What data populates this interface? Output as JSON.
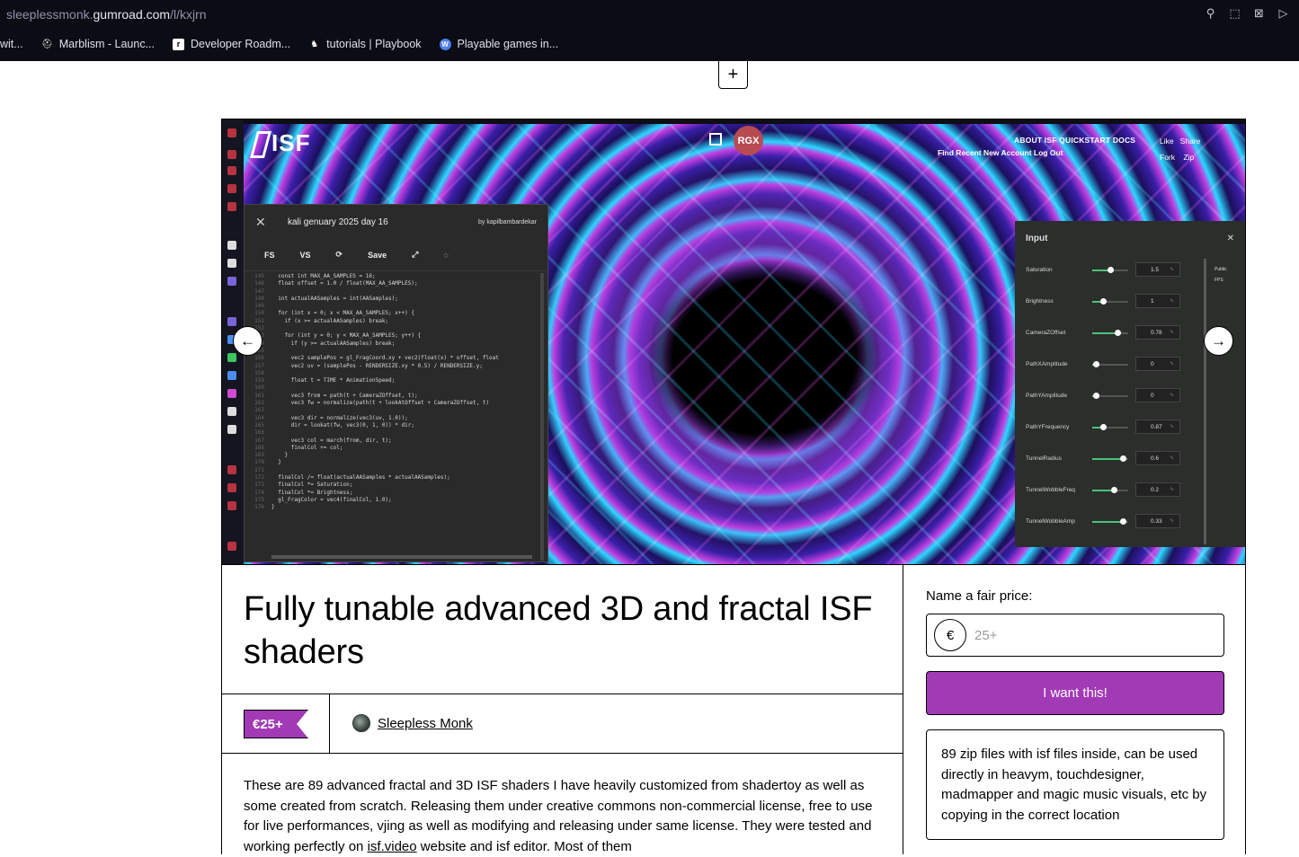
{
  "browser": {
    "url_prefix": "sleeplessmonk.",
    "url_host": "gumroad.com",
    "url_path": "/l/kxjrn",
    "bookmarks": [
      {
        "label": "wit...",
        "icon": "none"
      },
      {
        "label": "Marblism - Launc...",
        "icon": "marblism-icon"
      },
      {
        "label": "Developer Roadm...",
        "icon": "roadmap-icon"
      },
      {
        "label": "tutorials | Playbook",
        "icon": "playbook-icon"
      },
      {
        "label": "Playable games in...",
        "icon": "wordpress-icon"
      }
    ]
  },
  "page": {
    "add_label": "+"
  },
  "preview": {
    "logo_text": "ISF",
    "avatar_text": "RGX",
    "nav_top": "ABOUT ISF   QUICKSTART   DOCS",
    "nav_bottom": "Find    Recent    New    Account    Log Out",
    "nav_right": "Like   Share\nFork    Zip",
    "editor": {
      "title": "kali genuary 2025 day 16",
      "by": "by kapilbambardekar",
      "tools": [
        "FS",
        "VS",
        "Save"
      ],
      "code_lines": [
        {
          "n": "145",
          "t": "  const int MAX_AA_SAMPLES = 16;"
        },
        {
          "n": "146",
          "t": "  float offset = 1.0 / float(MAX_AA_SAMPLES);"
        },
        {
          "n": "147",
          "t": ""
        },
        {
          "n": "148",
          "t": "  int actualAASamples = int(AASamples);"
        },
        {
          "n": "149",
          "t": ""
        },
        {
          "n": "150",
          "t": "  for (int x = 0; x < MAX_AA_SAMPLES; x++) {"
        },
        {
          "n": "151",
          "t": "    if (x >= actualAASamples) break;"
        },
        {
          "n": "152",
          "t": ""
        },
        {
          "n": "153",
          "t": "    for (int y = 0; y < MAX_AA_SAMPLES; y++) {"
        },
        {
          "n": "154",
          "t": "      if (y >= actualAASamples) break;"
        },
        {
          "n": "155",
          "t": ""
        },
        {
          "n": "156",
          "t": "      vec2 samplePos = gl_FragCoord.xy + vec2(float(x) * offset, float"
        },
        {
          "n": "157",
          "t": "      vec2 uv = (samplePos - RENDERSIZE.xy * 0.5) / RENDERSIZE.y;"
        },
        {
          "n": "158",
          "t": ""
        },
        {
          "n": "159",
          "t": "      float t = TIME * AnimationSpeed;"
        },
        {
          "n": "160",
          "t": ""
        },
        {
          "n": "161",
          "t": "      vec3 from = path(t + CameraZOffset, t);"
        },
        {
          "n": "162",
          "t": "      vec3 fw = normalize(path(t + lookAtOffset + CameraZOffset, t)"
        },
        {
          "n": "163",
          "t": ""
        },
        {
          "n": "164",
          "t": "      vec3 dir = normalize(vec3(uv, 1.0));"
        },
        {
          "n": "165",
          "t": "      dir = lookat(fw, vec3(0, 1, 0)) * dir;"
        },
        {
          "n": "166",
          "t": ""
        },
        {
          "n": "167",
          "t": "      vec3 col = march(from, dir, t);"
        },
        {
          "n": "168",
          "t": "      finalCol += col;"
        },
        {
          "n": "169",
          "t": "    }"
        },
        {
          "n": "170",
          "t": "  }"
        },
        {
          "n": "171",
          "t": ""
        },
        {
          "n": "172",
          "t": "  finalCol /= float(actualAASamples * actualAASamples);"
        },
        {
          "n": "173",
          "t": "  finalCol *= Saturation;"
        },
        {
          "n": "174",
          "t": "  finalCol *= Brightness;"
        },
        {
          "n": "175",
          "t": "  gl_FragColor = vec4(finalCol, 1.0);"
        },
        {
          "n": "176",
          "t": "}"
        }
      ]
    },
    "inputs": {
      "title": "Input",
      "side_labels": [
        "Public",
        "FPS"
      ],
      "rows": [
        {
          "label": "Saturation",
          "value": "1.5",
          "level": 0.5
        },
        {
          "label": "Brightness",
          "value": "1",
          "level": 0.3
        },
        {
          "label": "CameraZOffset",
          "value": "0.78",
          "level": 0.7
        },
        {
          "label": "PathXAmplitude",
          "value": "0",
          "level": 0.1
        },
        {
          "label": "PathYAmplitude",
          "value": "0",
          "level": 0.1
        },
        {
          "label": "PathYFrequency",
          "value": "0.87",
          "level": 0.3
        },
        {
          "label": "TunnelRadius",
          "value": "0.6",
          "level": 0.85
        },
        {
          "label": "TunnelWobbleFreq",
          "value": "0.2",
          "level": 0.6
        },
        {
          "label": "TunnelWobbleAmp",
          "value": "0.33",
          "level": 0.85
        }
      ]
    },
    "prev_label": "←",
    "next_label": "→"
  },
  "product": {
    "title": "Fully tunable advanced 3D and fractal ISF shaders",
    "price_tag": "€25+",
    "creator_name": "Sleepless Monk",
    "description_before": "These are 89 advanced fractal and 3D ISF shaders I have heavily customized from shadertoy as well as some created from scratch. Releasing them under creative commons non-commercial license, free to use for live performances, vjing as well as modifying and releasing under same license. They were tested and working perfectly on ",
    "description_link": "isf.video",
    "description_after": " website and isf editor. Most of them"
  },
  "purchase": {
    "label": "Name a fair price:",
    "currency": "€",
    "placeholder": "25+",
    "buy_label": "I want this!",
    "summary": "89 zip files with isf files inside, can be used directly in heavym, touchdesigner, madmapper and magic music visuals, etc by copying in the correct location"
  },
  "colors": {
    "accent": "#a23ab6",
    "chrome_bg": "#0b0c14"
  }
}
